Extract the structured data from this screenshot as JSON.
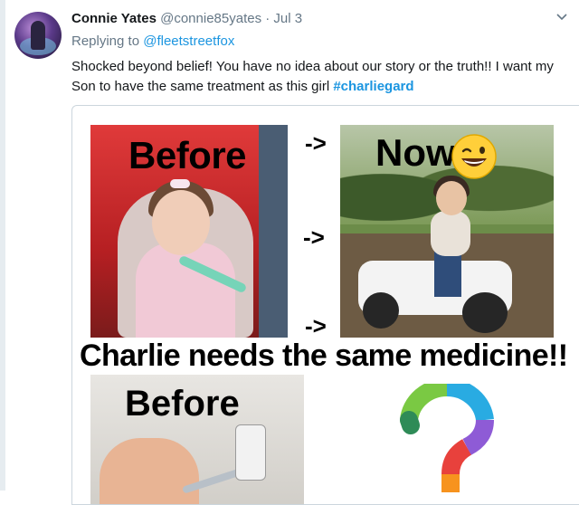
{
  "tweet": {
    "author_name": "Connie Yates",
    "author_handle": "@connie85yates",
    "separator": "·",
    "timestamp": "Jul 3",
    "replying_prefix": "Replying to",
    "replying_to": "@fleetstreetfox",
    "text": "Shocked beyond belief! You have no idea about our story or the truth!! I want my Son to have the same treatment as this girl",
    "hashtag": "#charliegard"
  },
  "media": {
    "label_before_top": "Before",
    "label_now": "Now",
    "arrow_1": "->",
    "arrow_2": "->",
    "arrow_3": "->",
    "headline": "Charlie needs the same medicine!!",
    "label_before_bottom": "Before"
  },
  "colors": {
    "link": "#1b95e0",
    "muted": "#657786",
    "text": "#14171a",
    "border": "#ccd6dd"
  },
  "icons": {
    "menu_caret": "chevron-down-icon",
    "emoji": "grinning-winking-face-icon",
    "puzzle": "puzzle-question-mark-icon"
  }
}
